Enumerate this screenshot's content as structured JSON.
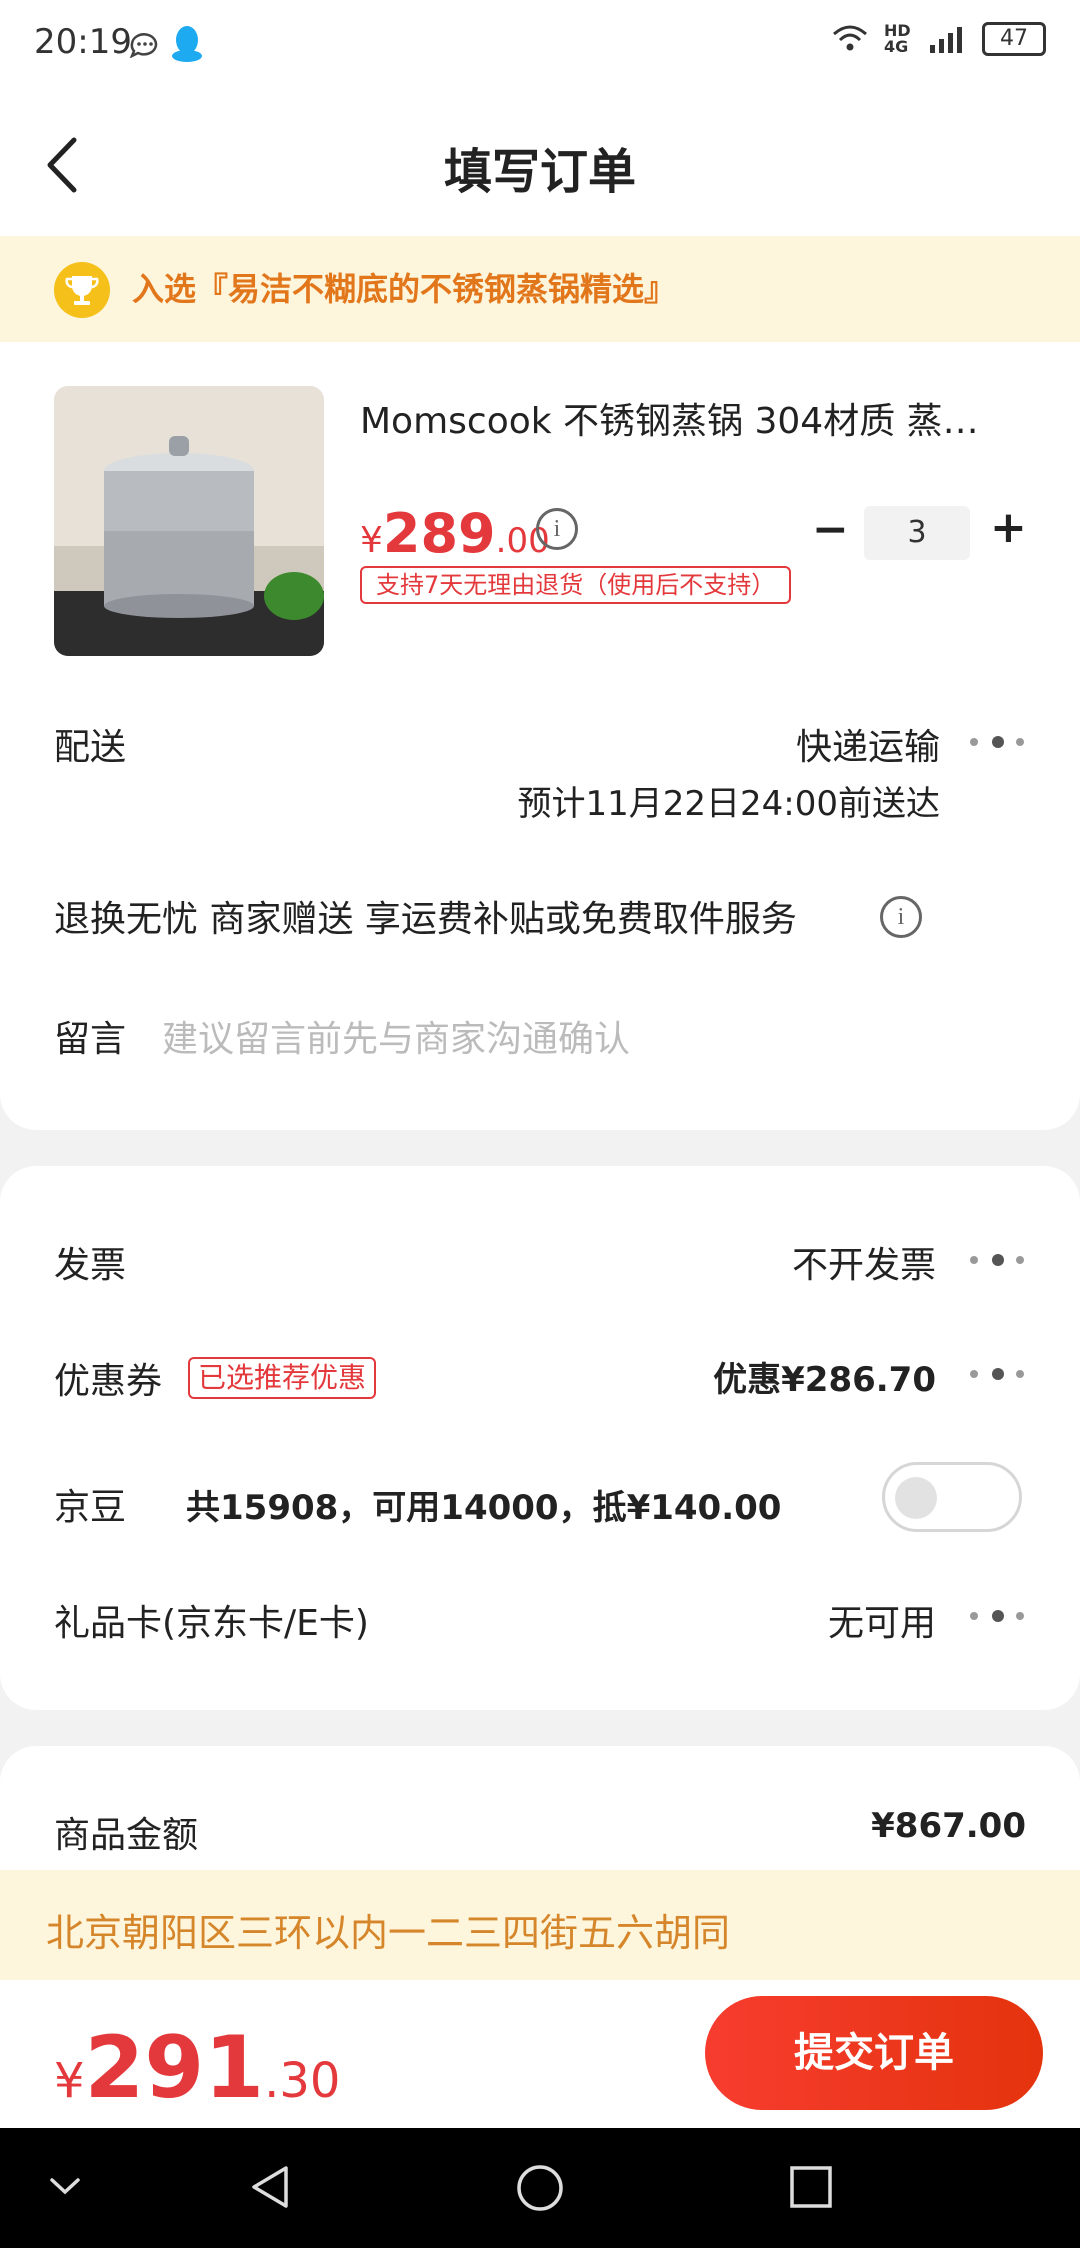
{
  "status_bar": {
    "time": "20:19",
    "network": "HD 4G",
    "battery": "47"
  },
  "header": {
    "title": "填写订单"
  },
  "banner": {
    "text": "入选『易洁不糊底的不锈钢蒸锅精选』"
  },
  "product": {
    "title": "Momscook 不锈钢蒸锅  304材质 蒸…",
    "price_currency": "¥",
    "price_int": "289",
    "price_dec": ".00",
    "quantity": "3",
    "return_policy": "支持7天无理由退货（使用后不支持）"
  },
  "delivery": {
    "label": "配送",
    "method": "快递运输",
    "eta": "预计11月22日24:00前送达"
  },
  "service": {
    "text": "退换无忧 商家赠送  享运费补贴或免费取件服务"
  },
  "message": {
    "label": "留言",
    "placeholder": "建议留言前先与商家沟通确认"
  },
  "invoice": {
    "label": "发票",
    "value": "不开发票"
  },
  "coupon": {
    "label": "优惠券",
    "tag": "已选推荐优惠",
    "value": "优惠¥286.70"
  },
  "jingdou": {
    "label": "京豆",
    "detail": "共15908，可用14000，抵¥140.00",
    "enabled": false
  },
  "gift_card": {
    "label": "礼品卡(京东卡/E卡)",
    "value": "无可用"
  },
  "summary": {
    "label": "商品金额",
    "value": "¥867.00"
  },
  "address": {
    "text": "北京朝阳区三环以内一二三四街五六胡同"
  },
  "total": {
    "currency": "¥",
    "int": "291",
    "dec": ".30"
  },
  "submit": {
    "label": "提交订单"
  },
  "colors": {
    "accent": "#e4393c",
    "banner_bg": "#fdf5dc",
    "banner_text": "#e2761b"
  }
}
